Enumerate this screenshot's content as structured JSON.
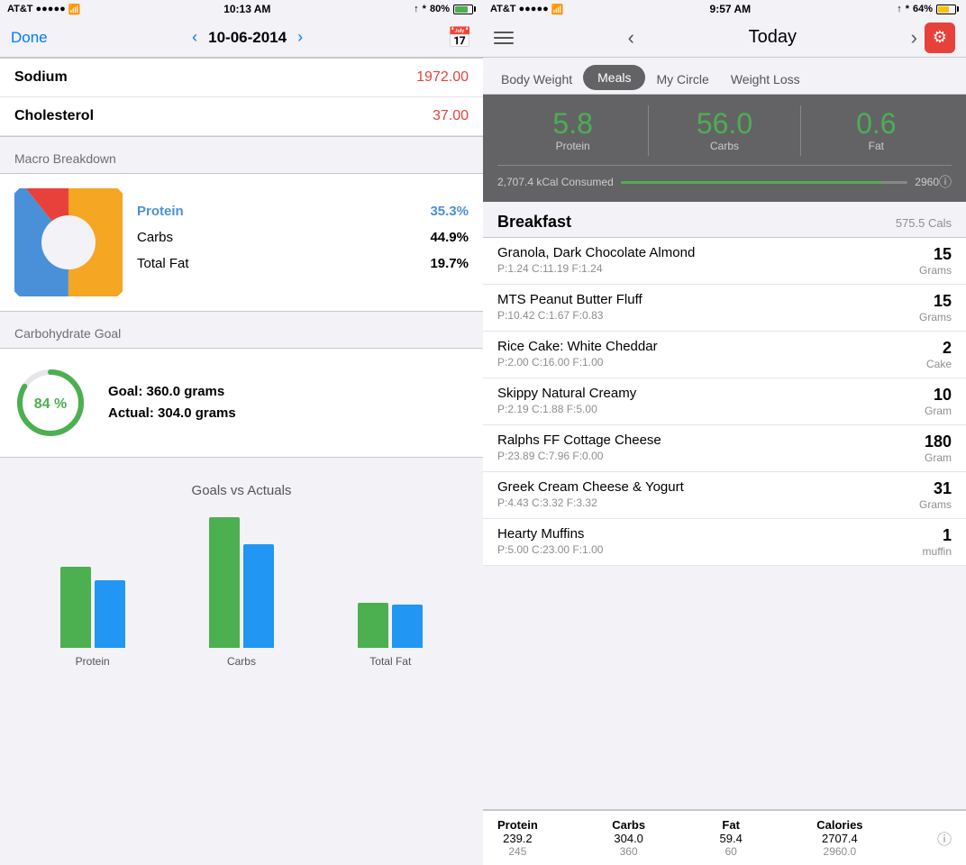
{
  "left": {
    "status": {
      "carrier": "AT&T",
      "time": "10:13 AM",
      "battery": "80%",
      "battery_fill": "80"
    },
    "nav": {
      "done": "Done",
      "date": "10-06-2014",
      "back_arrow": "‹",
      "forward_arrow": "›"
    },
    "nutrients": [
      {
        "label": "Sodium",
        "value": "1972.00",
        "color": "red"
      },
      {
        "label": "Cholesterol",
        "value": "37.00",
        "color": "red"
      }
    ],
    "macro_section_title": "Macro Breakdown",
    "macros": [
      {
        "label": "Protein",
        "value": "35.3%",
        "highlight": true
      },
      {
        "label": "Carbs",
        "value": "44.9%",
        "highlight": false
      },
      {
        "label": "Total Fat",
        "value": "19.7%",
        "highlight": false
      }
    ],
    "carb_goal_title": "Carbohydrate Goal",
    "carb_goal_percent": "84 %",
    "carb_goal_grams": "Goal: 360.0 grams",
    "carb_actual_grams": "Actual: 304.0 grams",
    "goals_actuals_title": "Goals vs Actuals",
    "bar_data": [
      {
        "label": "Protein",
        "goal": 90,
        "actual": 75
      },
      {
        "label": "Carbs",
        "goal": 145,
        "actual": 115
      },
      {
        "label": "Total Fat",
        "goal": 50,
        "actual": 48
      }
    ]
  },
  "right": {
    "status": {
      "carrier": "AT&T",
      "time": "9:57 AM",
      "battery": "64%",
      "battery_fill": "64"
    },
    "nav": {
      "today": "Today",
      "back_arrow": "‹",
      "forward_arrow": "›"
    },
    "tabs": [
      {
        "label": "Body Weight",
        "active": false
      },
      {
        "label": "Meals",
        "active": true
      },
      {
        "label": "My Circle",
        "active": false
      },
      {
        "label": "Weight Loss",
        "active": false
      }
    ],
    "summary": {
      "protein": "5.8",
      "protein_label": "Protein",
      "carbs": "56.0",
      "carbs_label": "Carbs",
      "fat": "0.6",
      "fat_label": "Fat",
      "consumed": "2,707.4 kCal Consumed",
      "goal": "2960",
      "progress_pct": "91"
    },
    "breakfast": {
      "title": "Breakfast",
      "cals": "575.5 Cals",
      "items": [
        {
          "name": "Granola, Dark Chocolate Almond",
          "macros": "P:1.24  C:11.19  F:1.24",
          "qty": "15",
          "unit": "Grams"
        },
        {
          "name": "MTS Peanut Butter Fluff",
          "macros": "P:10.42  C:1.67  F:0.83",
          "qty": "15",
          "unit": "Grams"
        },
        {
          "name": "Rice Cake: White Cheddar",
          "macros": "P:2.00  C:16.00  F:1.00",
          "qty": "2",
          "unit": "Cake"
        },
        {
          "name": "Skippy Natural Creamy",
          "macros": "P:2.19  C:1.88  F:5.00",
          "qty": "10",
          "unit": "Gram"
        },
        {
          "name": "Ralphs FF Cottage Cheese",
          "macros": "P:23.89  C:7.96  F:0.00",
          "qty": "180",
          "unit": "Gram"
        },
        {
          "name": "Greek Cream Cheese & Yogurt",
          "macros": "P:4.43  C:3.32  F:3.32",
          "qty": "31",
          "unit": "Grams"
        },
        {
          "name": "Hearty Muffins",
          "macros": "P:5.00  C:23.00  F:1.00",
          "qty": "1",
          "unit": "muffin"
        }
      ]
    },
    "bottom": {
      "protein_label": "Protein",
      "protein_val": "239.2",
      "protein_goal": "245",
      "carbs_label": "Carbs",
      "carbs_val": "304.0",
      "carbs_goal": "360",
      "fat_label": "Fat",
      "fat_val": "59.4",
      "fat_goal": "60",
      "calories_label": "Calories",
      "calories_val": "2707.4",
      "calories_goal": "2960.0"
    }
  }
}
